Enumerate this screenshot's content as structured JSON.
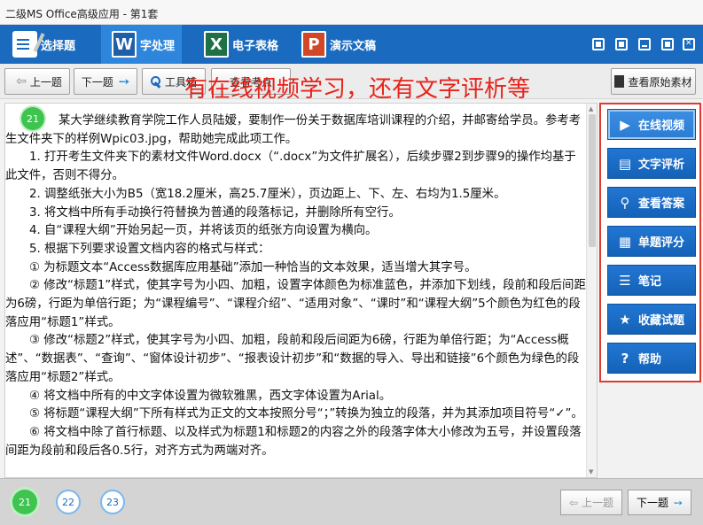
{
  "window": {
    "title": "二级MS Office高级应用 - 第1套"
  },
  "menu": {
    "items": [
      {
        "label": "选择题",
        "icon": "checklist-icon"
      },
      {
        "label": "字处理",
        "icon": "word-icon",
        "glyph": "W"
      },
      {
        "label": "电子表格",
        "icon": "excel-icon",
        "glyph": "X"
      },
      {
        "label": "演示文稿",
        "icon": "powerpoint-icon",
        "glyph": "P"
      }
    ],
    "active": "字处理"
  },
  "toolbar": {
    "prev_label": "上一题",
    "next_label": "下一题",
    "tools_label": "工具箱",
    "hidden_label": "查看考点",
    "view_material_label": "查看原始素材"
  },
  "overlay_text": "有在线视频学习，还有文字评析等",
  "question": {
    "number": "21",
    "paragraphs": [
      "某大学继续教育学院工作人员陆嫒，要制作一份关于数据库培训课程的介绍，并邮寄给学员。参考考生文件夹下的样例Wpic03.jpg，帮助她完成此项工作。",
      "1. 打开考生文件夹下的素材文件Word.docx（“.docx”为文件扩展名），后续步骤2到步骤9的操作均基于此文件，否则不得分。",
      "2. 调整纸张大小为B5（宽18.2厘米，高25.7厘米），页边距上、下、左、右均为1.5厘米。",
      "3. 将文档中所有手动换行符替换为普通的段落标记，并删除所有空行。",
      "4. 自“课程大纲”开始另起一页，并将该页的纸张方向设置为横向。",
      "5. 根据下列要求设置文档内容的格式与样式：",
      "① 为标题文本“Access数据库应用基础”添加一种恰当的文本效果，适当增大其字号。",
      "② 修改“标题1”样式，使其字号为小四、加粗，设置字体颜色为标准蓝色，并添加下划线，段前和段后间距为6磅，行距为单倍行距；为“课程编号”、“课程介绍”、“适用对象”、“课时”和“课程大纲”5个颜色为红色的段落应用“标题1”样式。",
      "③ 修改“标题2”样式，使其字号为小四、加粗，段前和段后间距为6磅，行距为单倍行距；为“Access概述”、“数据表”、“查询”、“窗体设计初步”、“报表设计初步”和“数据的导入、导出和链接”6个颜色为绿色的段落应用“标题2”样式。",
      "④ 将文档中所有的中文字体设置为微软雅黑，西文字体设置为Arial。",
      "⑤ 将标题“课程大纲”下所有样式为正文的文本按照分号“；”转换为独立的段落，并为其添加项目符号“✓”。",
      "⑥ 将文档中除了首行标题、以及样式为标题1和标题2的内容之外的段落字体大小修改为五号，并设置段落间距为段前和段后各0.5行，对齐方式为两端对齐。"
    ]
  },
  "sidebar": {
    "items": [
      {
        "label": "在线视频",
        "icon": "video-icon"
      },
      {
        "label": "文字评析",
        "icon": "document-icon"
      },
      {
        "label": "查看答案",
        "icon": "search-icon"
      },
      {
        "label": "单题评分",
        "icon": "score-icon"
      },
      {
        "label": "笔记",
        "icon": "notes-icon"
      },
      {
        "label": "收藏试题",
        "icon": "star-icon"
      },
      {
        "label": "帮助",
        "icon": "help-icon"
      }
    ]
  },
  "bottom": {
    "questions": [
      "21",
      "22",
      "23"
    ],
    "prev_label": "上一题",
    "next_label": "下一题"
  },
  "colors": {
    "brand": "#1a6bbf",
    "highlight_border": "#e03a2e",
    "overlay_text": "#e8221a",
    "done": "#3ec44f"
  }
}
